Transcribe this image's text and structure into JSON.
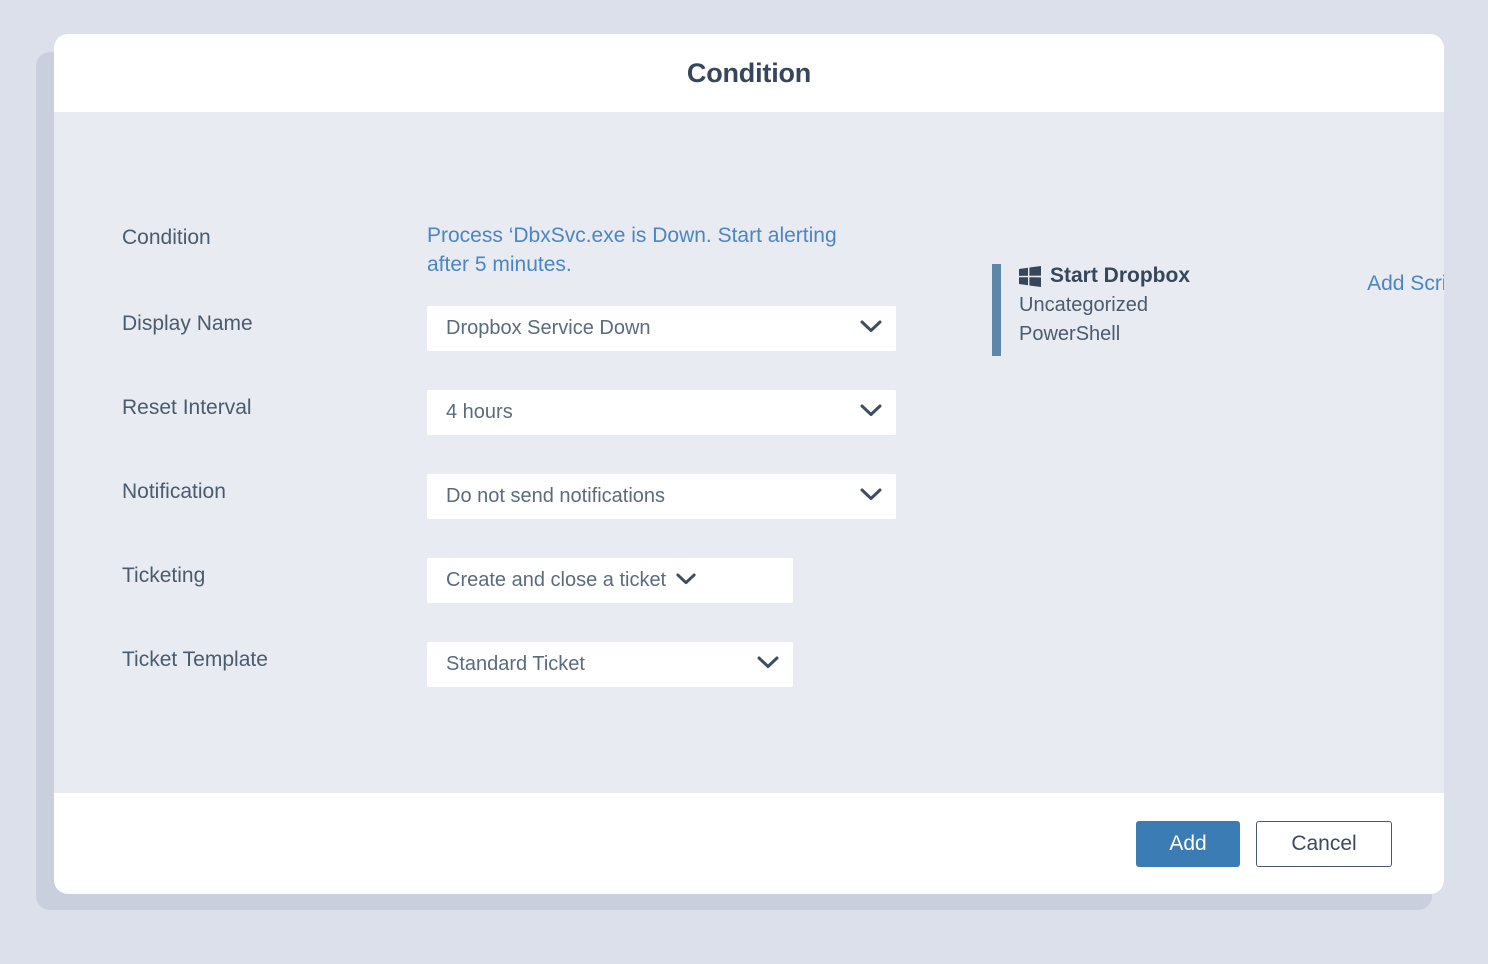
{
  "window": {
    "title": "Condition"
  },
  "form": {
    "rows": [
      {
        "label": "Condition",
        "type": "text",
        "value": "Process ‘DbxSvc.exe is Down. Start alerting after 5 minutes."
      },
      {
        "label": "Display Name",
        "type": "select",
        "value": "Dropbox Service Down",
        "width": "wide"
      },
      {
        "label": "Reset Interval",
        "type": "select",
        "value": "4 hours",
        "width": "wide"
      },
      {
        "label": "Notification",
        "type": "select",
        "value": "Do not send notifications",
        "width": "wide"
      },
      {
        "label": "Ticketing",
        "type": "select",
        "value": "Create and close a ticket",
        "width": "narrow-snug"
      },
      {
        "label": "Ticket Template",
        "type": "select",
        "value": "Standard Ticket",
        "width": "narrow"
      }
    ]
  },
  "script_panel": {
    "icon": "windows-icon",
    "title": "Start Dropbox",
    "category": "Uncategorized",
    "language": "PowerShell",
    "add_script_label": "Add Script"
  },
  "footer": {
    "add_label": "Add",
    "cancel_label": "Cancel"
  },
  "colors": {
    "page_background": "#dbe0ea",
    "modal_body": "#e8ebf2",
    "accent_blue": "#3b7cb5",
    "link_blue": "#4a86c4",
    "script_accent": "#5c87a8",
    "title_text": "#36465b",
    "label_text": "#4b5b6e"
  }
}
